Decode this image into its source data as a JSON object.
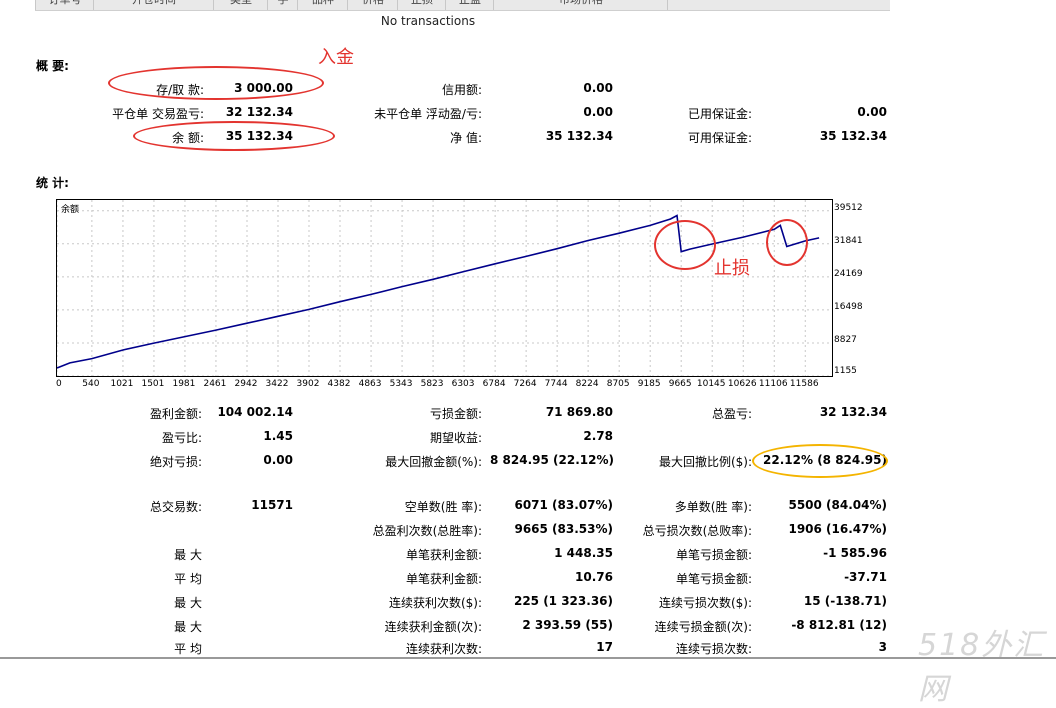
{
  "header_columns": [
    "订单号",
    "开仓时间",
    "类型",
    "手",
    "品种",
    "价格",
    "止损",
    "止盈",
    "市场价格"
  ],
  "no_transactions": "No transactions",
  "summary": {
    "title": "概 要:",
    "deposit_label": "存/取 款:",
    "deposit_value": "3 000.00",
    "credit_label": "信用额:",
    "credit_value": "0.00",
    "closed_pl_label": "平仓单 交易盈亏:",
    "closed_pl_value": "32 132.34",
    "floating_label": "未平仓单 浮动盈/亏:",
    "floating_value": "0.00",
    "margin_used_label": "已用保证金:",
    "margin_used_value": "0.00",
    "balance_label": "余 额:",
    "balance_value": "35 132.34",
    "equity_label": "净 值:",
    "equity_value": "35 132.34",
    "free_margin_label": "可用保证金:",
    "free_margin_value": "35 132.34"
  },
  "annotations": {
    "deposit_note": "入金",
    "stoploss_note": "止损"
  },
  "stats": {
    "title": "统 计:",
    "rows": [
      {
        "l1": "盈利金额:",
        "v1": "104 002.14",
        "l2": "亏损金额:",
        "v2": "71 869.80",
        "l3": "总盈亏:",
        "v3": "32 132.34"
      },
      {
        "l1": "盈亏比:",
        "v1": "1.45",
        "l2": "期望收益:",
        "v2": "2.78",
        "l3": "",
        "v3": ""
      },
      {
        "l1": "绝对亏损:",
        "v1": "0.00",
        "l2": "最大回撤金额(%):",
        "v2": "8 824.95 (22.12%)",
        "l3": "最大回撤比例($):",
        "v3": "22.12% (8 824.95)"
      },
      {
        "l1": "总交易数:",
        "v1": "11571",
        "l2": "空单数(胜 率):",
        "v2": "6071 (83.07%)",
        "l3": "多单数(胜 率):",
        "v3": "5500 (84.04%)"
      },
      {
        "l1": "",
        "v1": "",
        "l2": "总盈利次数(总胜率):",
        "v2": "9665 (83.53%)",
        "l3": "总亏损次数(总败率):",
        "v3": "1906 (16.47%)"
      },
      {
        "l1": "最 大",
        "v1": "",
        "l2": "单笔获利金额:",
        "v2": "1 448.35",
        "l3": "单笔亏损金额:",
        "v3": "-1 585.96"
      },
      {
        "l1": "平 均",
        "v1": "",
        "l2": "单笔获利金额:",
        "v2": "10.76",
        "l3": "单笔亏损金额:",
        "v3": "-37.71"
      },
      {
        "l1": "最 大",
        "v1": "",
        "l2": "连续获利次数($):",
        "v2": "225 (1 323.36)",
        "l3": "连续亏损次数($):",
        "v3": "15 (-138.71)"
      },
      {
        "l1": "最 大",
        "v1": "",
        "l2": "连续获利金额(次):",
        "v2": "2 393.59 (55)",
        "l3": "连续亏损金额(次):",
        "v3": "-8 812.81 (12)"
      },
      {
        "l1": "平 均",
        "v1": "",
        "l2": "连续获利次数:",
        "v2": "17",
        "l3": "连续亏损次数:",
        "v3": "3"
      }
    ]
  },
  "watermark": "518外汇网",
  "colors": {
    "line": "#00008b",
    "grid": "#c8c8c8",
    "red_mark": "#e3342f",
    "orange_mark": "#f4b400"
  },
  "chart_data": {
    "type": "line",
    "title": "余额",
    "x_ticks": [
      "0",
      "540",
      "1021",
      "1501",
      "1981",
      "2461",
      "2942",
      "3422",
      "3902",
      "4382",
      "4863",
      "5343",
      "5823",
      "6303",
      "6784",
      "7264",
      "7744",
      "8224",
      "8705",
      "9185",
      "9665",
      "10145",
      "10626",
      "11106",
      "11586"
    ],
    "y_ticks": [
      "39512",
      "31841",
      "24169",
      "16498",
      "8827",
      "1155"
    ],
    "xlim": [
      0,
      12000
    ],
    "ylim": [
      1155,
      42000
    ],
    "series": [
      {
        "x": [
          0,
          200,
          540,
          1021,
          1501,
          1981,
          2461,
          2942,
          3422,
          3902,
          4382,
          4863,
          5343,
          5823,
          6303,
          6784,
          7264,
          7744,
          8224,
          8705,
          9185,
          9500,
          9600,
          9665,
          9800,
          10145,
          10626,
          11106,
          11200,
          11300,
          11586,
          11800
        ],
        "y": [
          3000,
          4200,
          5200,
          7200,
          8800,
          10300,
          11800,
          13400,
          15000,
          16600,
          18400,
          20100,
          21900,
          23600,
          25400,
          27200,
          28900,
          30700,
          32600,
          34300,
          36100,
          37600,
          38400,
          30000,
          30600,
          31800,
          33400,
          35200,
          36100,
          31200,
          32500,
          33200
        ]
      }
    ]
  }
}
